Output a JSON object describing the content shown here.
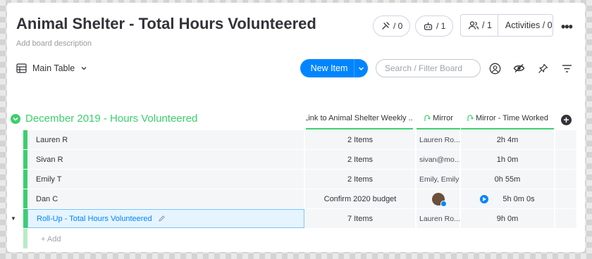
{
  "board": {
    "title": "Animal Shelter - Total Hours Volunteered",
    "description": "Add board description",
    "integrations_count": "/ 0",
    "automations_count": "/ 1",
    "members_count": "/ 1",
    "activities_label": "Activities / 0"
  },
  "toolbar": {
    "view_label": "Main Table",
    "new_item_label": "New Item",
    "search_placeholder": "Search / Filter Board"
  },
  "group": {
    "title": "December 2019 - Hours Volunteered",
    "color": "#3ccf6e",
    "columns": [
      {
        "label": "Link to Animal Shelter Weekly ..."
      },
      {
        "label": "Mirror"
      },
      {
        "label": "Mirror - Time Worked"
      }
    ],
    "add_label": "+ Add"
  },
  "rows": [
    {
      "name": "Lauren R",
      "link": "2 Items",
      "mirror": "Lauren Ro...",
      "time": "2h 4m"
    },
    {
      "name": "Sivan R",
      "link": "2 Items",
      "mirror": "sivan@mo...",
      "time": "1h 0m"
    },
    {
      "name": "Emily T",
      "link": "2 Items",
      "mirror": "Emily, Emily",
      "time": "0h 55m"
    },
    {
      "name": "Dan C",
      "link": "Confirm 2020 budget",
      "mirror": "",
      "time": "5h 0m 0s"
    },
    {
      "name": "Roll-Up - Total Hours Volunteered",
      "link": "7 Items",
      "mirror": "Lauren Ro...",
      "time": "9h 0m"
    }
  ]
}
